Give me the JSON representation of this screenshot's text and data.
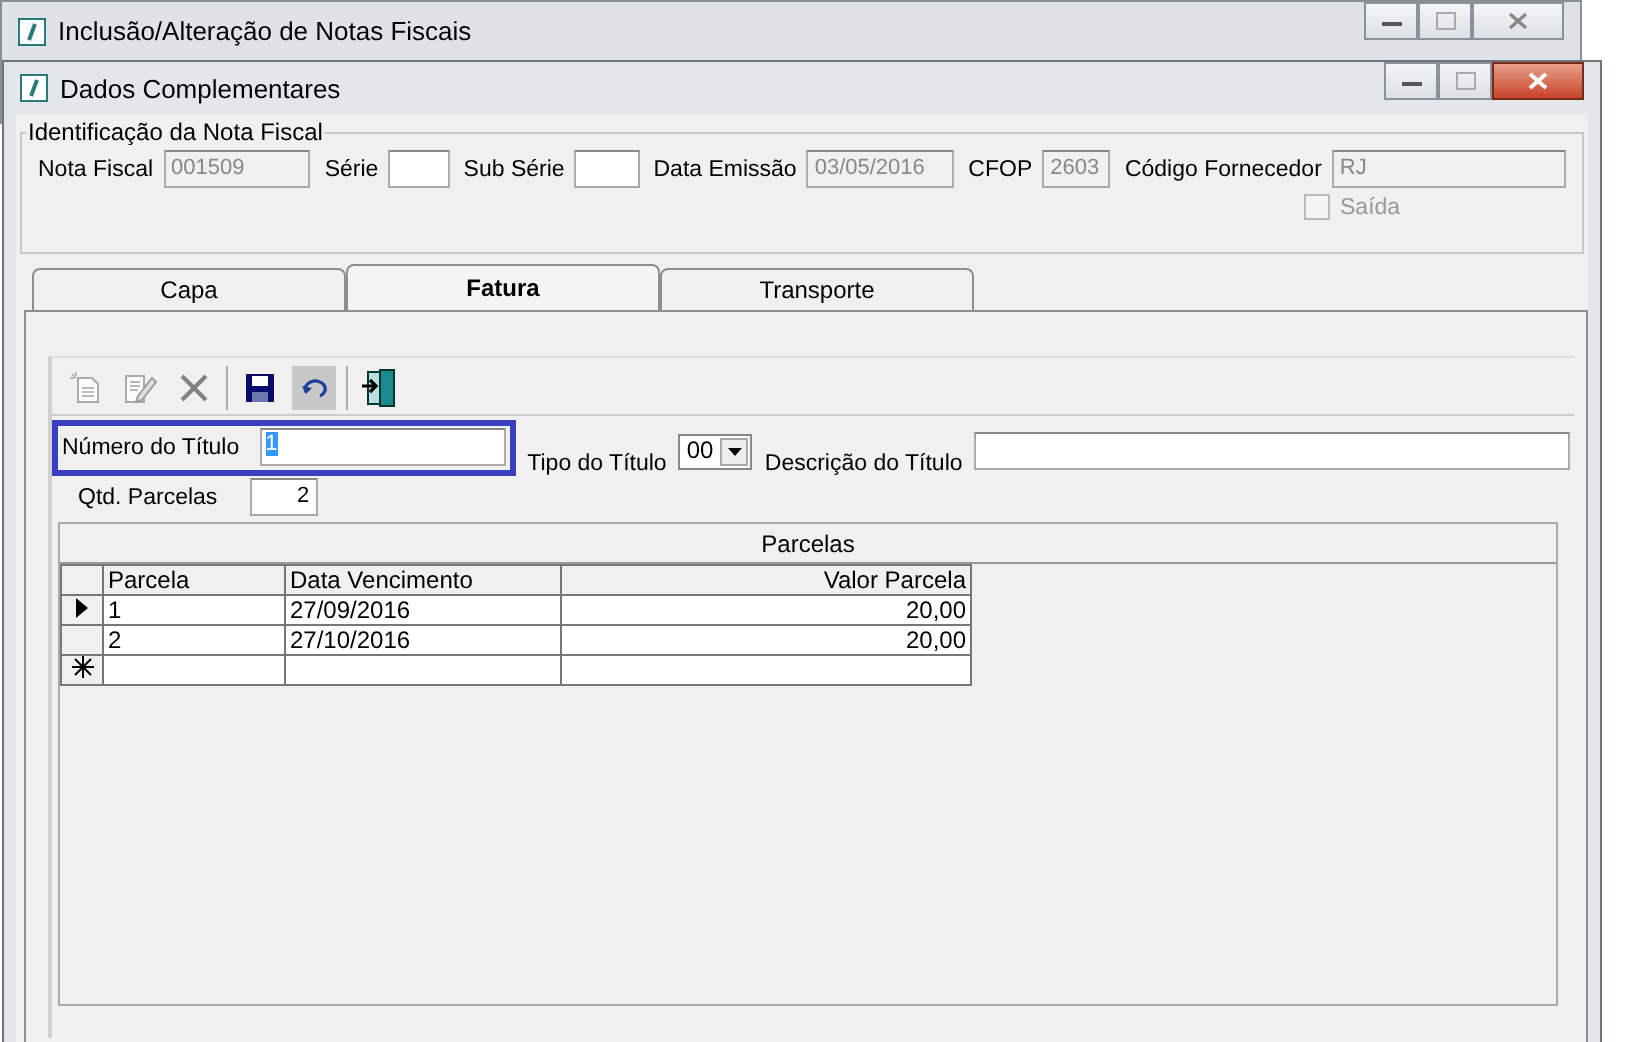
{
  "back_window": {
    "title": "Inclusão/Alteração de Notas Fiscais"
  },
  "window": {
    "title": "Dados Complementares"
  },
  "identification": {
    "legend": "Identificação da Nota Fiscal",
    "fields": [
      {
        "label": "Nota Fiscal",
        "value": "001509",
        "disabled": true
      },
      {
        "label": "Série",
        "disabled": false
      },
      {
        "label": "Sub Série",
        "disabled": false
      },
      {
        "label": "Data Emissão",
        "value": "03/05/2016",
        "disabled": true
      },
      {
        "label": "CFOP",
        "value": "2603",
        "disabled": true
      },
      {
        "label": "Código Fornecedor",
        "value": "RJ",
        "disabled": true
      }
    ],
    "saida": {
      "label": "Saída",
      "checked": false,
      "disabled": true
    }
  },
  "tabs": [
    {
      "label": "Capa",
      "selected": false
    },
    {
      "label": "Fatura",
      "selected": true
    },
    {
      "label": "Transporte",
      "selected": false
    }
  ],
  "toolbar": [
    {
      "kind": "new",
      "disabled": true
    },
    {
      "kind": "edit",
      "disabled": true
    },
    {
      "kind": "delete",
      "disabled": true
    },
    {
      "kind": "save",
      "disabled": false
    },
    {
      "kind": "undo",
      "disabled": false
    },
    {
      "kind": "exit",
      "disabled": false
    }
  ],
  "titulo": {
    "numero_label": "Número do Título",
    "numero_value": "1",
    "tipo_label": "Tipo do Título",
    "tipo_value": "00",
    "descricao_label": "Descrição do Título",
    "qtd_label": "Qtd. Parcelas",
    "qtd_value": "2"
  },
  "grid": {
    "caption": "Parcelas",
    "columns": [
      "Parcela",
      "Data Vencimento",
      "Valor Parcela"
    ],
    "rows": [
      {
        "cells": [
          "1",
          "27/09/2016",
          "20,00"
        ],
        "selected": true
      },
      {
        "cells": [
          "2",
          "27/10/2016",
          "20,00"
        ],
        "selected": false
      }
    ]
  }
}
